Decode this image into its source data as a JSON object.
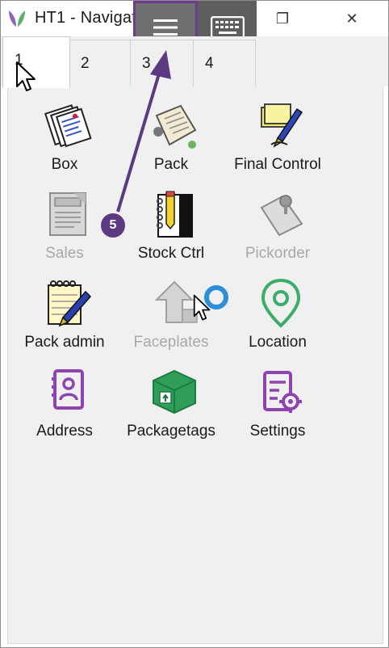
{
  "window": {
    "title": "HT1 - Navigator",
    "restore_glyph": "❐",
    "close_glyph": "✕"
  },
  "overlay": {
    "menu_icon": "hamburger-menu-icon",
    "keyboard_icon": "keyboard-icon",
    "accent": "#6b3d8f"
  },
  "tabs": [
    {
      "label": "1",
      "active": true
    },
    {
      "label": "2",
      "active": false
    },
    {
      "label": "3",
      "active": false
    },
    {
      "label": "4",
      "active": false
    }
  ],
  "items": [
    {
      "label": "Box",
      "icon": "box-documents-icon",
      "enabled": true
    },
    {
      "label": "Pack",
      "icon": "pack-parcel-icon",
      "enabled": true
    },
    {
      "label": "Final Control",
      "icon": "final-control-note-pen-icon",
      "enabled": true
    },
    {
      "label": "Sales",
      "icon": "sales-register-icon",
      "enabled": false
    },
    {
      "label": "Stock Ctrl",
      "icon": "stock-ctrl-notebook-icon",
      "enabled": true
    },
    {
      "label": "Pickorder",
      "icon": "pickorder-pin-note-icon",
      "enabled": false
    },
    {
      "label": "Pack admin",
      "icon": "pack-admin-notepad-pen-icon",
      "enabled": true
    },
    {
      "label": "Faceplates",
      "icon": "faceplates-arrow-icon",
      "enabled": false
    },
    {
      "label": "Location",
      "icon": "location-pin-icon",
      "enabled": true
    },
    {
      "label": "Address",
      "icon": "address-book-icon",
      "enabled": true
    },
    {
      "label": "Packagetags",
      "icon": "packagetags-box-icon",
      "enabled": true
    },
    {
      "label": "Settings",
      "icon": "settings-gear-list-icon",
      "enabled": true
    }
  ],
  "annotation": {
    "step_number": "5",
    "color": "#5b3a82"
  }
}
